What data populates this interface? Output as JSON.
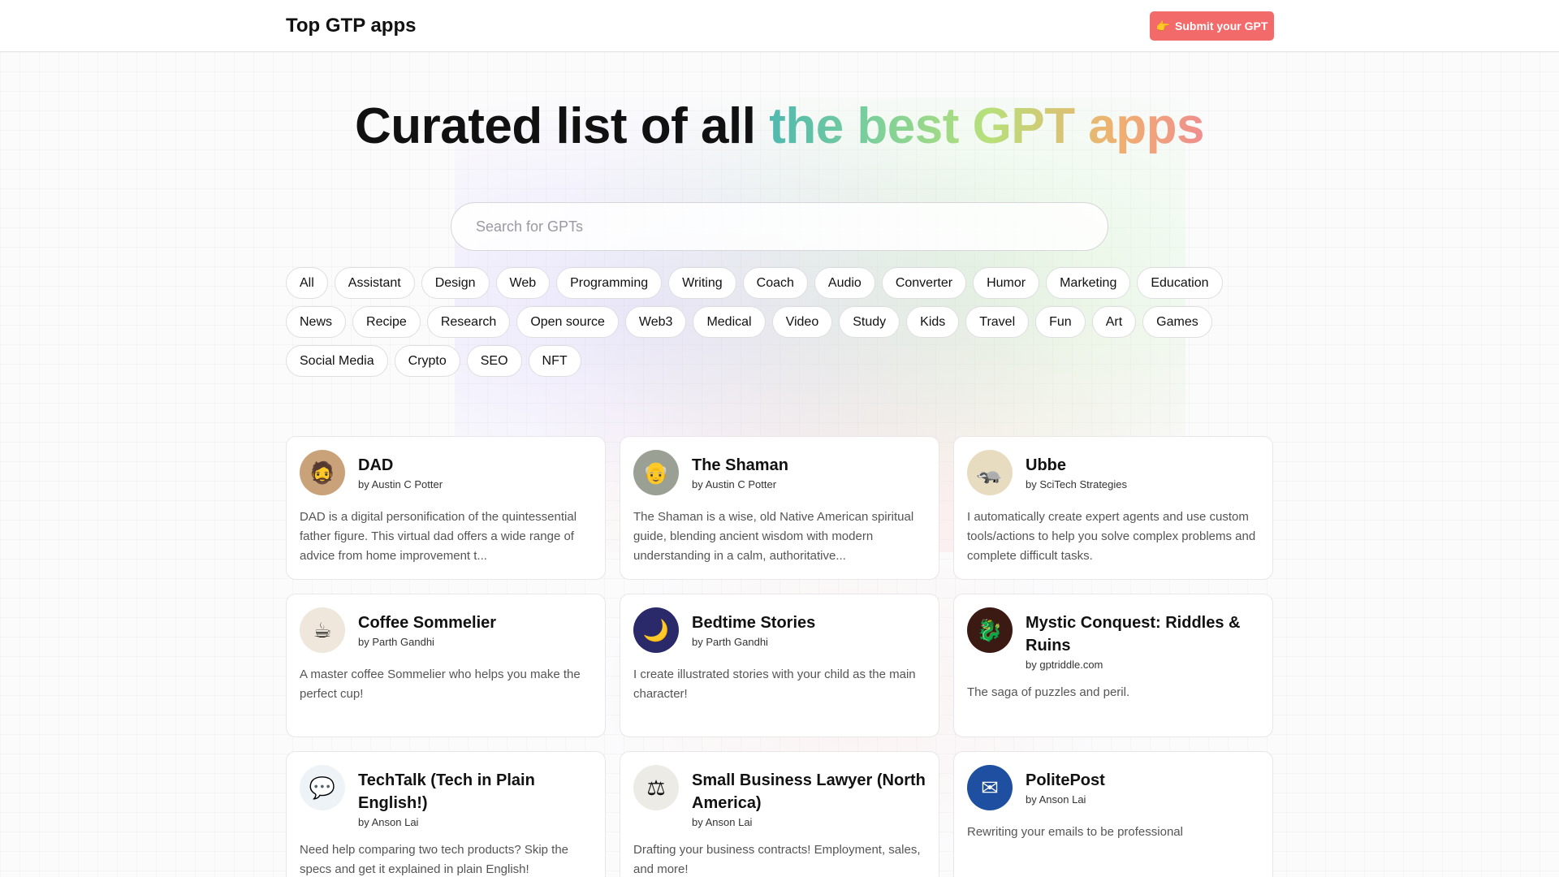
{
  "header": {
    "brand": "Top GTP apps",
    "submit_emoji": "👉",
    "submit_label": "Submit your GPT"
  },
  "hero": {
    "title_plain": "Curated list of all ",
    "title_gradient": "the best GPT apps"
  },
  "search": {
    "placeholder": "Search for GPTs",
    "value": ""
  },
  "tags": [
    "All",
    "Assistant",
    "Design",
    "Web",
    "Programming",
    "Writing",
    "Coach",
    "Audio",
    "Converter",
    "Humor",
    "Marketing",
    "Education",
    "News",
    "Recipe",
    "Research",
    "Open source",
    "Web3",
    "Medical",
    "Video",
    "Study",
    "Kids",
    "Travel",
    "Fun",
    "Art",
    "Games",
    "Social Media",
    "Crypto",
    "SEO",
    "NFT"
  ],
  "cards": [
    {
      "title": "DAD",
      "author": "by Austin C Potter",
      "description": "DAD is a digital personification of the quintessential father figure. This virtual dad offers a wide range of advice from home improvement t...",
      "icon": "bearded-man-icon",
      "color": "#c9a27a"
    },
    {
      "title": "The Shaman",
      "author": "by Austin C Potter",
      "description": "The Shaman is a wise, old Native American spiritual guide, blending ancient wisdom with modern understanding in a calm, authoritative...",
      "icon": "elder-portrait-icon",
      "color": "#9aa094"
    },
    {
      "title": "Ubbe",
      "author": "by SciTech Strategies",
      "description": "I automatically create expert agents and use custom tools/actions to help you solve complex problems and complete difficult tasks.",
      "icon": "ferret-icon",
      "color": "#e8dcc0"
    },
    {
      "title": "Coffee Sommelier",
      "author": "by Parth Gandhi",
      "description": "A master coffee Sommelier who helps you make the perfect cup!",
      "icon": "coffee-cup-icon",
      "color": "#efe6dc"
    },
    {
      "title": "Bedtime Stories",
      "author": "by Parth Gandhi",
      "description": "I create illustrated stories with your child as the main character!",
      "icon": "moon-night-icon",
      "color": "#2a2a6a"
    },
    {
      "title": "Mystic Conquest: Riddles & Ruins",
      "author": "by gptriddle.com",
      "description": "The saga of puzzles and peril.",
      "icon": "dragon-icon",
      "color": "#3a1a12"
    },
    {
      "title": "TechTalk (Tech in Plain English!)",
      "author": "by Anson Lai",
      "description": "Need help comparing two tech products? Skip the specs and get it explained in plain English!",
      "icon": "techtalk-logo-icon",
      "color": "#eef3f8"
    },
    {
      "title": "Small Business Lawyer (North America)",
      "author": "by Anson Lai",
      "description": "Drafting your business contracts! Employment, sales, and more!",
      "icon": "scales-icon",
      "color": "#ecebe6"
    },
    {
      "title": "PolitePost",
      "author": "by Anson Lai",
      "description": "Rewriting your emails to be professional",
      "icon": "envelope-icon",
      "color": "#1e4fa0"
    }
  ]
}
